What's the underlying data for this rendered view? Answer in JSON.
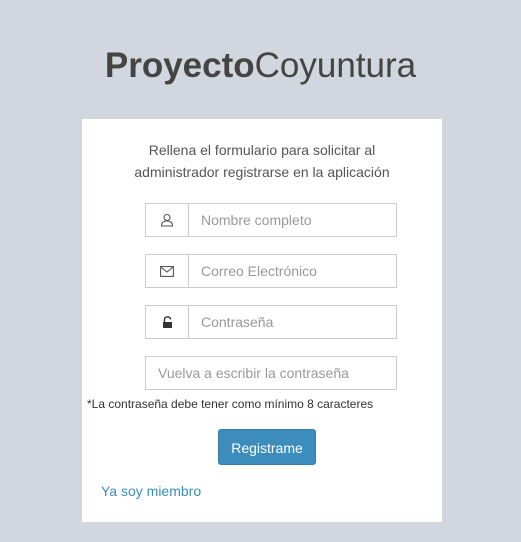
{
  "logo": {
    "bold": "Proyecto",
    "light": "Coyuntura"
  },
  "form": {
    "message_line1": "Rellena el formulario para solicitar al",
    "message_line2": "administrador registrarse en la aplicación",
    "fields": {
      "name": {
        "placeholder": "Nombre completo",
        "value": "",
        "icon": "user-icon"
      },
      "email": {
        "placeholder": "Correo Electrónico",
        "value": "",
        "icon": "envelope-icon"
      },
      "password": {
        "placeholder": "Contraseña",
        "value": "",
        "icon": "lock-icon"
      },
      "password_repeat": {
        "placeholder": "Vuelva a escribir la contraseña",
        "value": ""
      }
    },
    "password_note": "*La contraseña debe tener como mínimo 8 caracteres",
    "submit_label": "Registrame",
    "member_link": "Ya soy miembro"
  },
  "colors": {
    "background": "#d2d6de",
    "primary": "#3c8dbc",
    "text": "#444444"
  }
}
